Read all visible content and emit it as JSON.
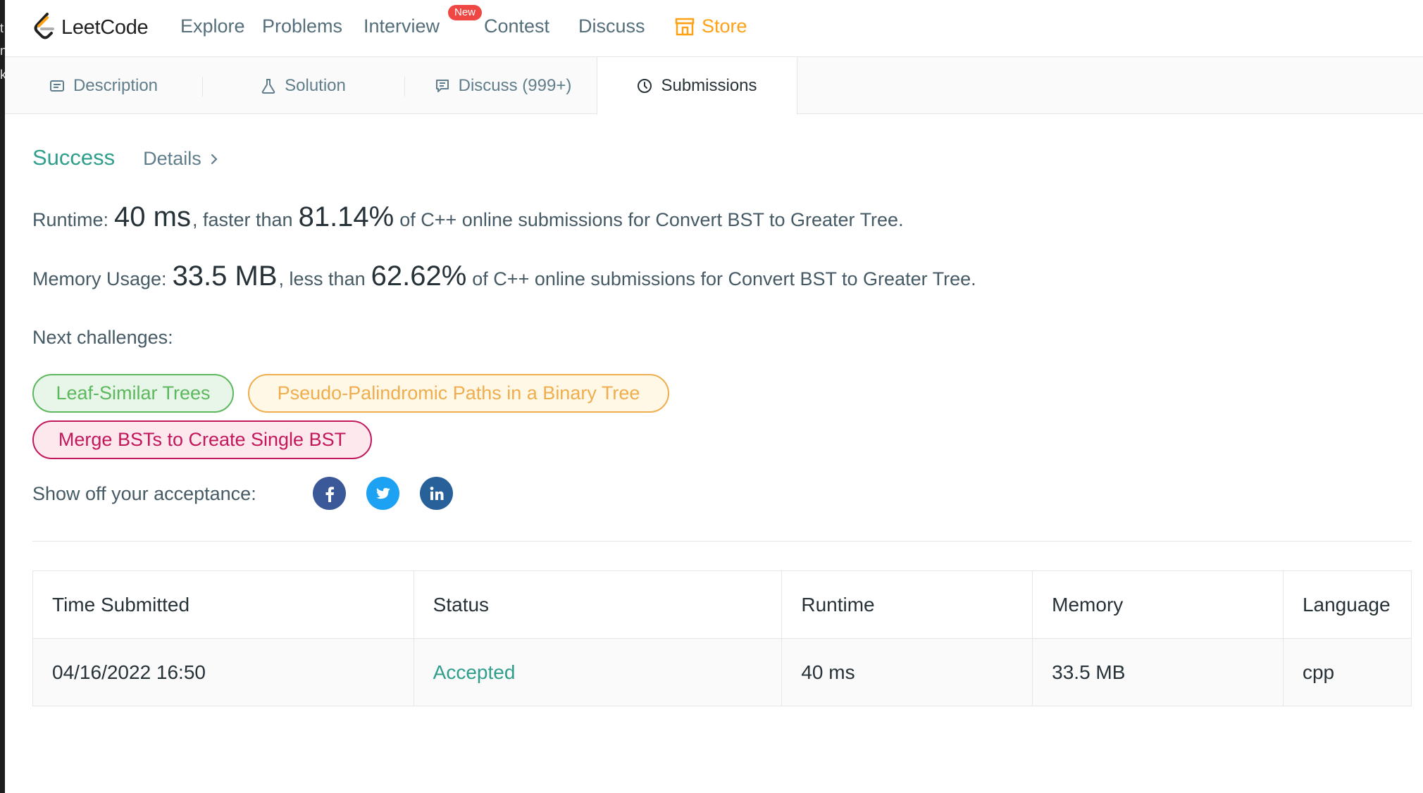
{
  "nav": {
    "logo_text": "LeetCode",
    "items": [
      "Explore",
      "Problems",
      "Interview",
      "Contest",
      "Discuss"
    ],
    "badge": "New",
    "store": "Store"
  },
  "tabs": [
    {
      "label": "Description",
      "icon": "description-icon"
    },
    {
      "label": "Solution",
      "icon": "flask-icon"
    },
    {
      "label": "Discuss (999+)",
      "icon": "chat-icon"
    },
    {
      "label": "Submissions",
      "icon": "clock-icon",
      "active": true
    }
  ],
  "result": {
    "status": "Success",
    "details": "Details",
    "runtime_prefix": "Runtime:",
    "runtime_value": "40 ms",
    "runtime_mid": ", faster than",
    "runtime_pct": "81.14%",
    "runtime_suffix": "of C++ online submissions for Convert BST to Greater Tree.",
    "memory_prefix": "Memory Usage:",
    "memory_value": "33.5 MB",
    "memory_mid": ", less than",
    "memory_pct": "62.62%",
    "memory_suffix": "of C++ online submissions for Convert BST to Greater Tree."
  },
  "next": {
    "label": "Next challenges:",
    "challenges": [
      {
        "title": "Leaf-Similar Trees",
        "difficulty": "easy"
      },
      {
        "title": "Pseudo-Palindromic Paths in a Binary Tree",
        "difficulty": "medium"
      },
      {
        "title": "Merge BSTs to Create Single BST",
        "difficulty": "hard"
      }
    ]
  },
  "share": {
    "label": "Show off your acceptance:",
    "icons": [
      "facebook-icon",
      "twitter-icon",
      "linkedin-icon"
    ]
  },
  "table": {
    "headers": [
      "Time Submitted",
      "Status",
      "Runtime",
      "Memory",
      "Language"
    ],
    "rows": [
      [
        "04/16/2022 16:50",
        "Accepted",
        "40 ms",
        "33.5 MB",
        "cpp"
      ]
    ]
  },
  "colors": {
    "accent_orange": "#ffa116",
    "success_teal": "#2f9e8b",
    "easy_green": "#5cb85c",
    "medium_orange": "#f0ad4e",
    "hard_red": "#c2185b",
    "badge_red": "#ef4743"
  }
}
